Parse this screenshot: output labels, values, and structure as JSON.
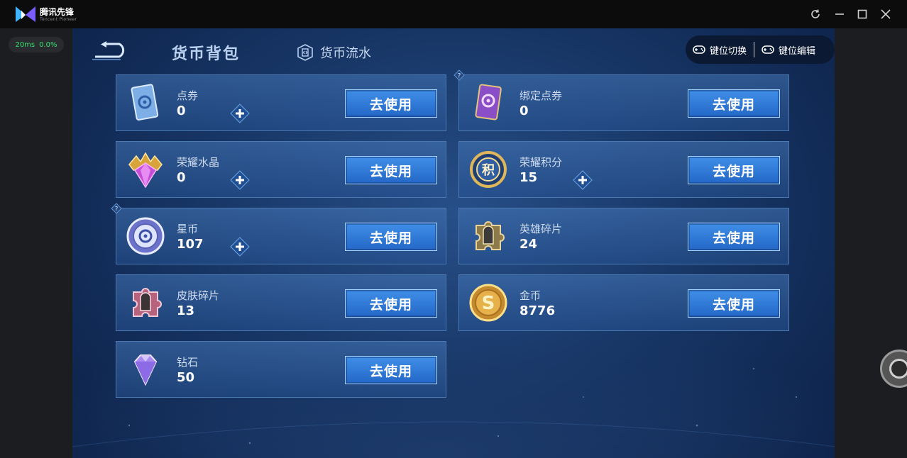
{
  "window": {
    "brand": "腾讯先锋",
    "brand_sub": "Tencent Pioneer",
    "perf_ping": "20ms",
    "perf_loss": "0.0%"
  },
  "nav": {
    "active_tab": "货币背包",
    "flow_tab": "货币流水"
  },
  "keybar": {
    "switch_label": "键位切换",
    "edit_label": "键位编辑"
  },
  "cards": [
    {
      "label": "点券",
      "value": "0",
      "plus": true,
      "help": false,
      "button": "去使用",
      "icon": "coupon-card-icon"
    },
    {
      "label": "绑定点券",
      "value": "0",
      "plus": false,
      "help": true,
      "button": "去使用",
      "icon": "bound-coupon-card-icon"
    },
    {
      "label": "荣耀水晶",
      "value": "0",
      "plus": true,
      "help": false,
      "button": "去使用",
      "icon": "honor-crystal-icon"
    },
    {
      "label": "荣耀积分",
      "value": "15",
      "plus": true,
      "help": false,
      "button": "去使用",
      "icon": "honor-points-coin-icon"
    },
    {
      "label": "星币",
      "value": "107",
      "plus": true,
      "help": true,
      "button": "去使用",
      "icon": "star-coin-icon"
    },
    {
      "label": "英雄碎片",
      "value": "24",
      "plus": false,
      "help": false,
      "button": "去使用",
      "icon": "hero-fragment-puzzle-icon"
    },
    {
      "label": "皮肤碎片",
      "value": "13",
      "plus": false,
      "help": false,
      "button": "去使用",
      "icon": "skin-fragment-puzzle-icon"
    },
    {
      "label": "金币",
      "value": "8776",
      "plus": false,
      "help": false,
      "button": "去使用",
      "icon": "gold-coin-icon"
    },
    {
      "label": "钻石",
      "value": "50",
      "plus": false,
      "help": false,
      "button": "去使用",
      "icon": "diamond-icon"
    }
  ],
  "colors": {
    "button_blue": "#2f7bd8",
    "card_border": "#4b78b1",
    "perf_green": "#36e070"
  }
}
